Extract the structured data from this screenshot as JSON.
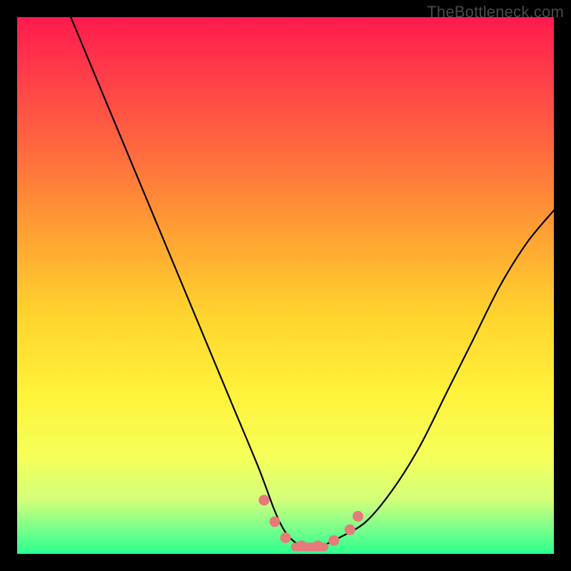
{
  "watermark": "TheBottleneck.com",
  "colors": {
    "frame_bg_top": "#ff1a4d",
    "frame_bg_bottom": "#2bff8f",
    "curve": "#000000",
    "marker": "#e77a7a",
    "page_bg": "#000000"
  },
  "chart_data": {
    "type": "line",
    "title": "",
    "xlabel": "",
    "ylabel": "",
    "xlim": [
      0,
      100
    ],
    "ylim": [
      0,
      100
    ],
    "grid": false,
    "legend": false,
    "series": [
      {
        "name": "bottleneck-curve",
        "x": [
          10,
          15,
          20,
          25,
          30,
          35,
          40,
          45,
          48,
          50,
          52,
          54,
          56,
          58,
          60,
          65,
          70,
          75,
          80,
          85,
          90,
          95,
          100
        ],
        "y": [
          100,
          88,
          76,
          64,
          52,
          40,
          28,
          16,
          8,
          4,
          2,
          1,
          1,
          2,
          3,
          6,
          12,
          20,
          30,
          40,
          50,
          58,
          64
        ]
      }
    ],
    "markers": [
      {
        "x": 46,
        "y": 10
      },
      {
        "x": 48,
        "y": 6
      },
      {
        "x": 50,
        "y": 3
      },
      {
        "x": 53,
        "y": 1.5
      },
      {
        "x": 56,
        "y": 1.5
      },
      {
        "x": 59,
        "y": 2.5
      },
      {
        "x": 62,
        "y": 4.5
      },
      {
        "x": 63.5,
        "y": 7
      }
    ],
    "flat_segment": {
      "x0": 51,
      "x1": 58,
      "y": 1.3
    },
    "annotations": []
  }
}
